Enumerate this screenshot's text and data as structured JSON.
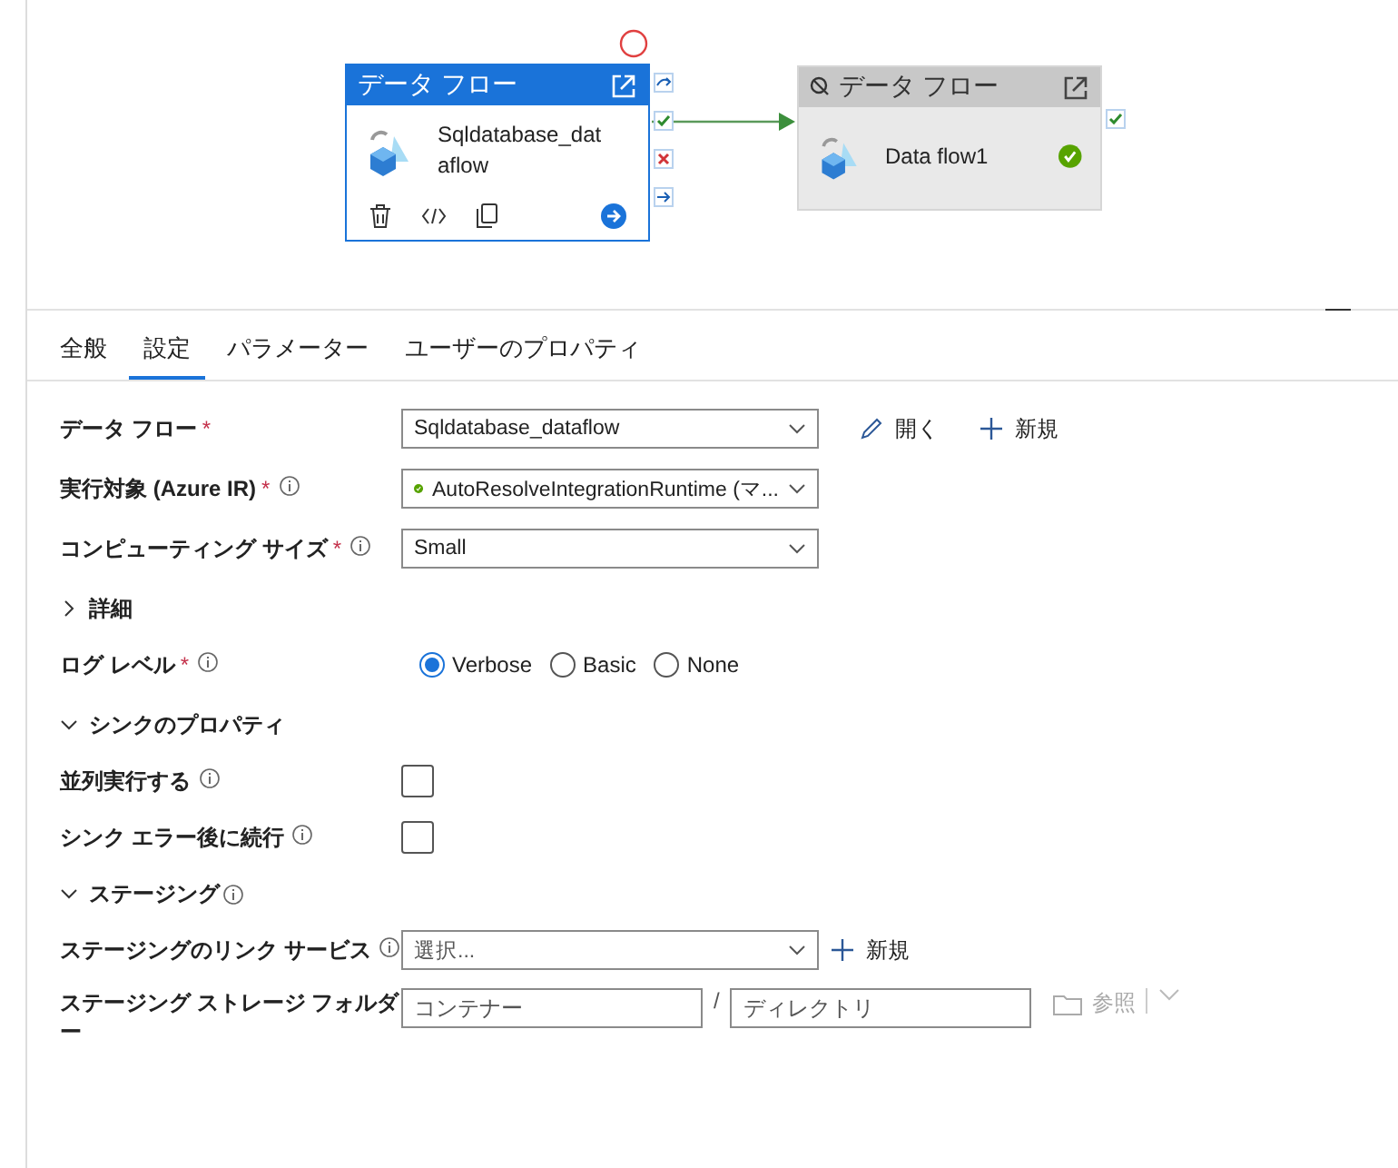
{
  "canvas": {
    "nodes": [
      {
        "title": "データ フロー",
        "name": "Sqldatabase_dataflow",
        "selected": true,
        "deactivated": false,
        "succeeded": false,
        "ports": [
          {
            "kind": "skip"
          },
          {
            "kind": "success"
          },
          {
            "kind": "failure"
          },
          {
            "kind": "completion"
          }
        ]
      },
      {
        "title": "データ フロー",
        "name": "Data flow1",
        "selected": false,
        "deactivated": true,
        "succeeded": true,
        "ports": [
          {
            "kind": "success"
          }
        ]
      }
    ]
  },
  "tabs": [
    {
      "label": "全般",
      "selected": false
    },
    {
      "label": "設定",
      "selected": true
    },
    {
      "label": "パラメーター",
      "selected": false
    },
    {
      "label": "ユーザーのプロパティ",
      "selected": false
    }
  ],
  "fields": [
    {
      "kind": "dropdown",
      "label": "データ フロー",
      "required": "*",
      "value": "Sqldatabase_dataflow",
      "actions": [
        {
          "kind": "open",
          "label": "開く"
        },
        {
          "kind": "new",
          "label": "新規"
        }
      ]
    },
    {
      "kind": "dropdown",
      "label": "実行対象 (Azure IR)",
      "required": "*",
      "info": true,
      "value": "AutoResolveIntegrationRuntime (マ...",
      "status_ok": true
    },
    {
      "kind": "dropdown",
      "label": "コンピューティング サイズ",
      "required": "*",
      "info": true,
      "value": "Small"
    },
    {
      "kind": "expander",
      "label": "詳細",
      "expanded": false
    },
    {
      "kind": "radios",
      "label": "ログ レベル",
      "required": "*",
      "info": true,
      "options": [
        {
          "label": "Verbose",
          "selected": true
        },
        {
          "label": "Basic",
          "selected": false
        },
        {
          "label": "None",
          "selected": false
        }
      ]
    },
    {
      "kind": "expander",
      "label": "シンクのプロパティ",
      "expanded": true
    },
    {
      "kind": "checkbox",
      "label": "並列実行する",
      "info": true,
      "checked": false
    },
    {
      "kind": "checkbox",
      "label": "シンク エラー後に続行",
      "info": true,
      "checked": false
    },
    {
      "kind": "expander",
      "label": "ステージング",
      "expanded": true,
      "info": true
    },
    {
      "kind": "dropdown",
      "label": "ステージングのリンク サービス",
      "info": true,
      "placeholder": "選択...",
      "actions": [
        {
          "kind": "new",
          "label": "新規"
        }
      ]
    },
    {
      "kind": "folder",
      "label": "ステージング ストレージ フォルダー",
      "container_placeholder": "コンテナー",
      "separator": "/",
      "directory_placeholder": "ディレクトリ",
      "browse": {
        "label": "参照",
        "disabled": true
      }
    }
  ]
}
